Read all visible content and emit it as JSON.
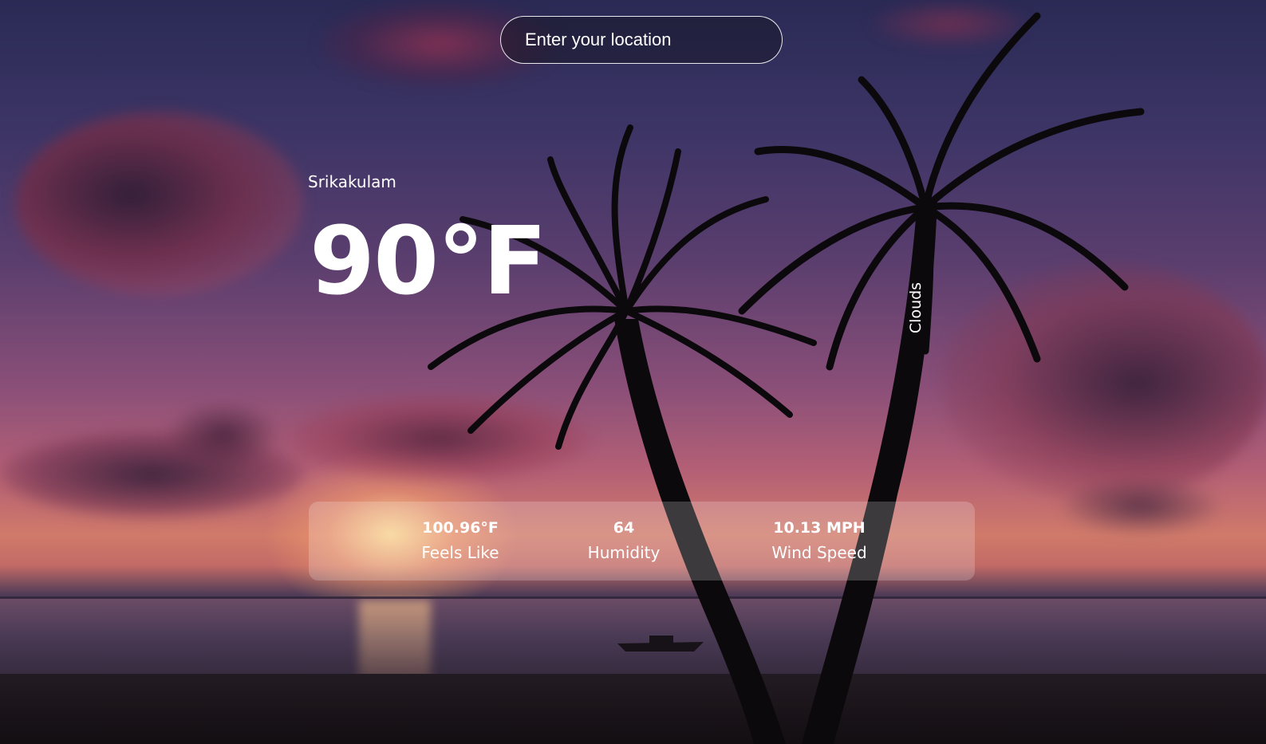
{
  "search": {
    "placeholder": "Enter your location",
    "value": ""
  },
  "weather": {
    "location": "Srikakulam",
    "temperature": "90°F",
    "description": "Clouds"
  },
  "stats": {
    "feels_like": {
      "value": "100.96°F",
      "label": "Feels Like"
    },
    "humidity": {
      "value": "64",
      "label": "Humidity"
    },
    "wind_speed": {
      "value": "10.13 MPH",
      "label": "Wind Speed"
    }
  },
  "colors": {
    "text": "#ffffff",
    "panel": "rgba(255,255,255,0.2)",
    "search_border": "#ffffff"
  }
}
